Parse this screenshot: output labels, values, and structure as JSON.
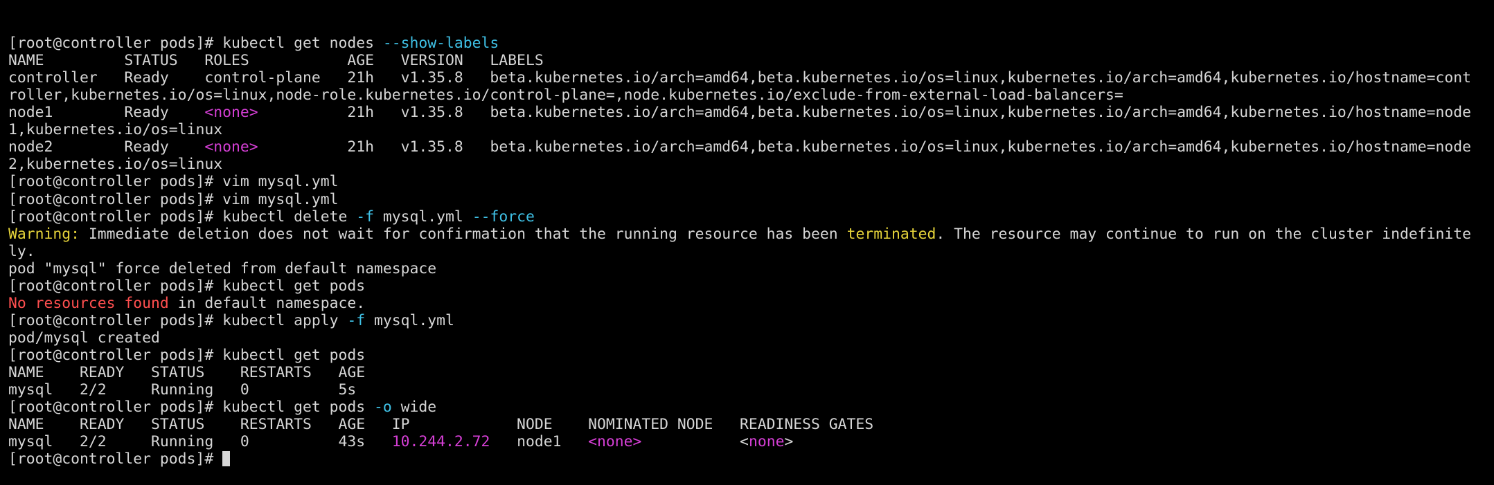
{
  "colors": {
    "background": "#000000",
    "foreground": "#d6d6d6",
    "flag": "#3fc1e6",
    "placeholder": "#d63fd6",
    "error": "#ff4f4f",
    "warning": "#e6d43a"
  },
  "lines": [
    [
      {
        "t": "[root@controller pods]# kubectl get nodes "
      },
      {
        "t": "--show-labels",
        "c": "cyan"
      }
    ],
    [
      {
        "t": "NAME         STATUS   ROLES           AGE   VERSION   LABELS"
      }
    ],
    [
      {
        "t": "controller   Ready    control-plane   21h   v1.35.8   beta.kubernetes.io/arch=amd64,beta.kubernetes.io/os=linux,kubernetes.io/arch=amd64,kubernetes.io/hostname=cont"
      }
    ],
    [
      {
        "t": "roller,kubernetes.io/os=linux,node-role.kubernetes.io/control-plane=,node.kubernetes.io/exclude-from-external-load-balancers="
      }
    ],
    [
      {
        "t": "node1        Ready    "
      },
      {
        "t": "<none>",
        "c": "magenta"
      },
      {
        "t": "          21h   v1.35.8   beta.kubernetes.io/arch=amd64,beta.kubernetes.io/os=linux,kubernetes.io/arch=amd64,kubernetes.io/hostname=node"
      }
    ],
    [
      {
        "t": "1,kubernetes.io/os=linux"
      }
    ],
    [
      {
        "t": "node2        Ready    "
      },
      {
        "t": "<none>",
        "c": "magenta"
      },
      {
        "t": "          21h   v1.35.8   beta.kubernetes.io/arch=amd64,beta.kubernetes.io/os=linux,kubernetes.io/arch=amd64,kubernetes.io/hostname=node"
      }
    ],
    [
      {
        "t": "2,kubernetes.io/os=linux"
      }
    ],
    [
      {
        "t": "[root@controller pods]# vim mysql.yml"
      }
    ],
    [
      {
        "t": "[root@controller pods]# vim mysql.yml"
      }
    ],
    [
      {
        "t": "[root@controller pods]# kubectl delete "
      },
      {
        "t": "-f",
        "c": "cyan"
      },
      {
        "t": " mysql.yml "
      },
      {
        "t": "--force",
        "c": "cyan"
      }
    ],
    [
      {
        "t": "Warning:",
        "c": "yellow"
      },
      {
        "t": " Immediate deletion does not wait for confirmation that the running resource has been "
      },
      {
        "t": "terminated",
        "c": "yellow"
      },
      {
        "t": ". The resource may continue to run on the cluster indefinite"
      }
    ],
    [
      {
        "t": "ly."
      }
    ],
    [
      {
        "t": "pod \"mysql\" force deleted from default namespace"
      }
    ],
    [
      {
        "t": "[root@controller pods]# kubectl get pods"
      }
    ],
    [
      {
        "t": "No resources found",
        "c": "red"
      },
      {
        "t": " in default namespace."
      }
    ],
    [
      {
        "t": "[root@controller pods]# kubectl apply "
      },
      {
        "t": "-f",
        "c": "cyan"
      },
      {
        "t": " mysql.yml"
      }
    ],
    [
      {
        "t": "pod/mysql created"
      }
    ],
    [
      {
        "t": "[root@controller pods]# kubectl get pods"
      }
    ],
    [
      {
        "t": "NAME    READY   STATUS    RESTARTS   AGE"
      }
    ],
    [
      {
        "t": "mysql   2/2     Running   0          5s"
      }
    ],
    [
      {
        "t": "[root@controller pods]# kubectl get pods "
      },
      {
        "t": "-o",
        "c": "cyan"
      },
      {
        "t": " wide"
      }
    ],
    [
      {
        "t": "NAME    READY   STATUS    RESTARTS   AGE   IP            NODE    NOMINATED NODE   READINESS GATES"
      }
    ],
    [
      {
        "t": "mysql   2/2     Running   0          43s   "
      },
      {
        "t": "10.244.2.72",
        "c": "magenta"
      },
      {
        "t": "   node1   "
      },
      {
        "t": "<none>",
        "c": "magenta"
      },
      {
        "t": "           <"
      },
      {
        "t": "none",
        "c": "magenta"
      },
      {
        "t": ">"
      }
    ],
    [
      {
        "t": "[root@controller pods]# "
      }
    ]
  ]
}
